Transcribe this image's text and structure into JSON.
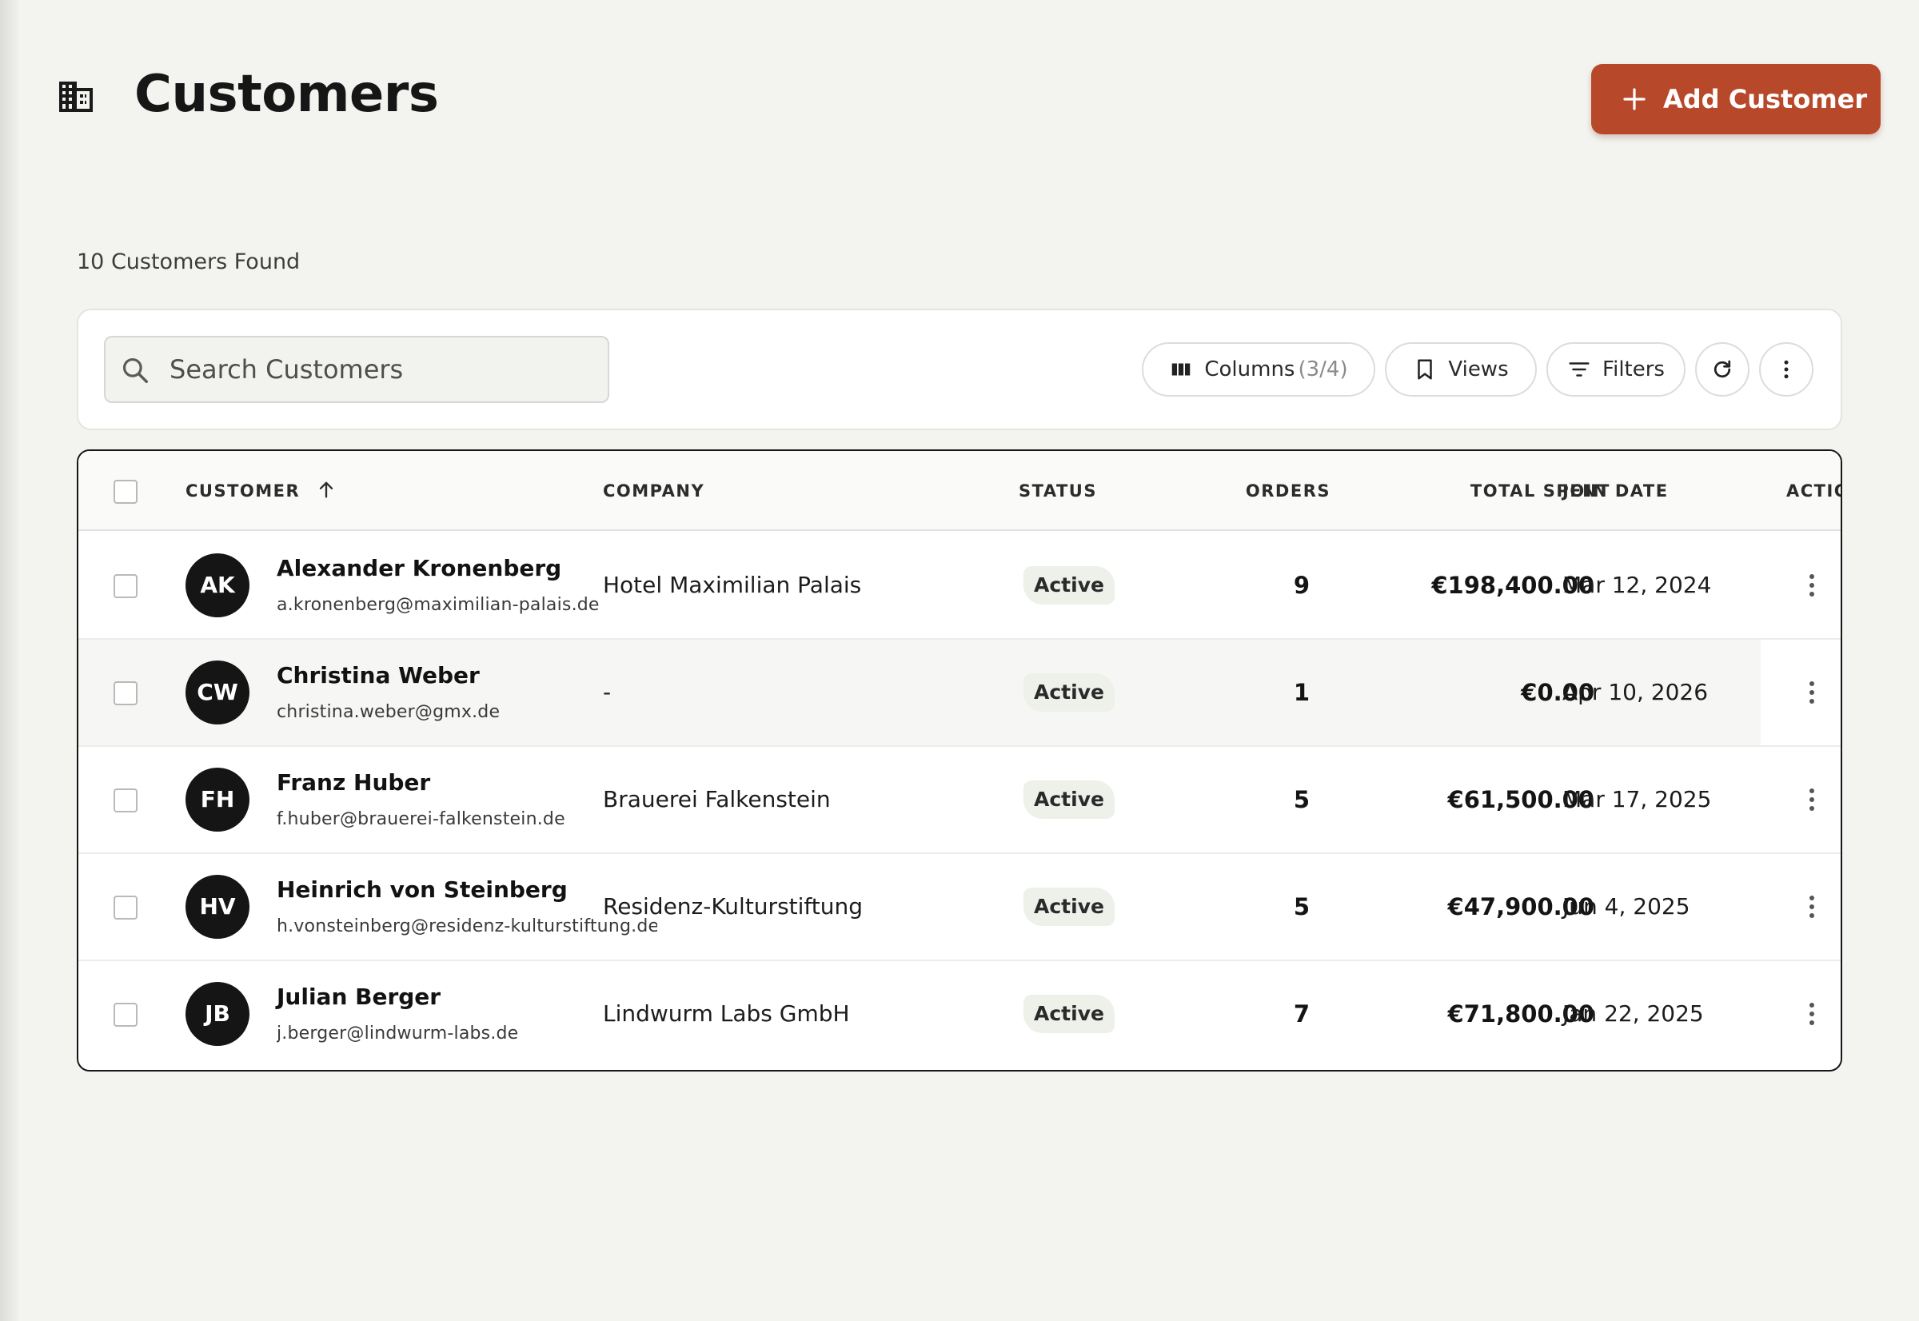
{
  "page": {
    "title": "Customers",
    "add_button_label": "Add Customer",
    "result_count": "10 Customers Found"
  },
  "toolbar": {
    "search_placeholder": "Search Customers",
    "columns_label": "Columns",
    "columns_count": "(3/4)",
    "views_label": "Views",
    "filters_label": "Filters"
  },
  "table": {
    "columns": {
      "customer": "CUSTOMER",
      "company": "COMPANY",
      "status": "STATUS",
      "orders": "ORDERS",
      "total_spent": "TOTAL SPENT",
      "join_date": "JOIN DATE",
      "actions": "ACTIONS"
    },
    "sort": {
      "column": "customer",
      "direction": "ascending"
    },
    "rows": [
      {
        "initials": "AK",
        "name": "Alexander Kronenberg",
        "email": "a.kronenberg@maximilian-palais.de",
        "company": "Hotel Maximilian Palais",
        "status": "Active",
        "orders": "9",
        "total_spent": "€198,400.00",
        "join_date": "Mar 12, 2024"
      },
      {
        "initials": "CW",
        "name": "Christina Weber",
        "email": "christina.weber@gmx.de",
        "company": "-",
        "status": "Active",
        "orders": "1",
        "total_spent": "€0.00",
        "join_date": "Apr 10, 2026"
      },
      {
        "initials": "FH",
        "name": "Franz Huber",
        "email": "f.huber@brauerei-falkenstein.de",
        "company": "Brauerei Falkenstein",
        "status": "Active",
        "orders": "5",
        "total_spent": "€61,500.00",
        "join_date": "Mar 17, 2025"
      },
      {
        "initials": "HV",
        "name": "Heinrich von Steinberg",
        "email": "h.vonsteinberg@residenz-kulturstiftung.de",
        "company": "Residenz-Kulturstiftung",
        "status": "Active",
        "orders": "5",
        "total_spent": "€47,900.00",
        "join_date": "Jun 4, 2025"
      },
      {
        "initials": "JB",
        "name": "Julian Berger",
        "email": "j.berger@lindwurm-labs.de",
        "company": "Lindwurm Labs GmbH",
        "status": "Active",
        "orders": "7",
        "total_spent": "€71,800.00",
        "join_date": "Jan 22, 2025"
      }
    ]
  },
  "colors": {
    "accent": "#b8482a",
    "background": "#f3f4f0",
    "avatar": "#151515"
  },
  "icons": {
    "title": "building-icon",
    "add": "plus-icon",
    "search": "search-icon",
    "columns": "columns-icon",
    "views": "bookmark-icon",
    "filters": "filter-icon",
    "refresh": "refresh-icon",
    "more": "more-vertical-icon",
    "sort": "arrow-up-icon",
    "row_actions": "more-vertical-icon"
  }
}
